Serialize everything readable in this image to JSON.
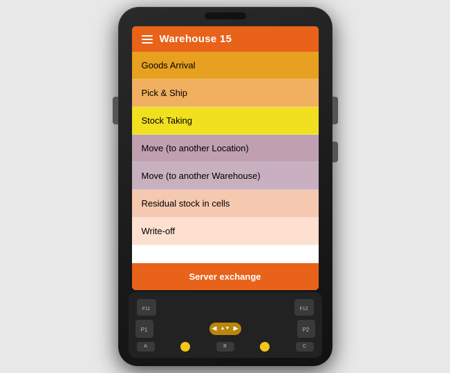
{
  "app": {
    "header": {
      "title": "Warehouse 15",
      "menu_icon": "hamburger"
    },
    "menu_items": [
      {
        "label": "Goods Arrival",
        "bg": "#e8a020"
      },
      {
        "label": "Pick & Ship",
        "bg": "#f0b060"
      },
      {
        "label": "Stock Taking",
        "bg": "#f0e020"
      },
      {
        "label": "Move (to another Location)",
        "bg": "#c0a0b0"
      },
      {
        "label": "Move (to another Warehouse)",
        "bg": "#c8b0c0"
      },
      {
        "label": "Residual stock in cells",
        "bg": "#f5c8b0"
      },
      {
        "label": "Write-off",
        "bg": "#fde0d0"
      }
    ],
    "server_exchange_btn": "Server exchange",
    "header_bg": "#e8621a",
    "server_btn_bg": "#e8621a"
  },
  "keypad": {
    "fn_left": "F11",
    "fn_right": "F12",
    "p1": "P1",
    "p2": "P2",
    "keys": [
      "A",
      "B",
      "C"
    ]
  }
}
